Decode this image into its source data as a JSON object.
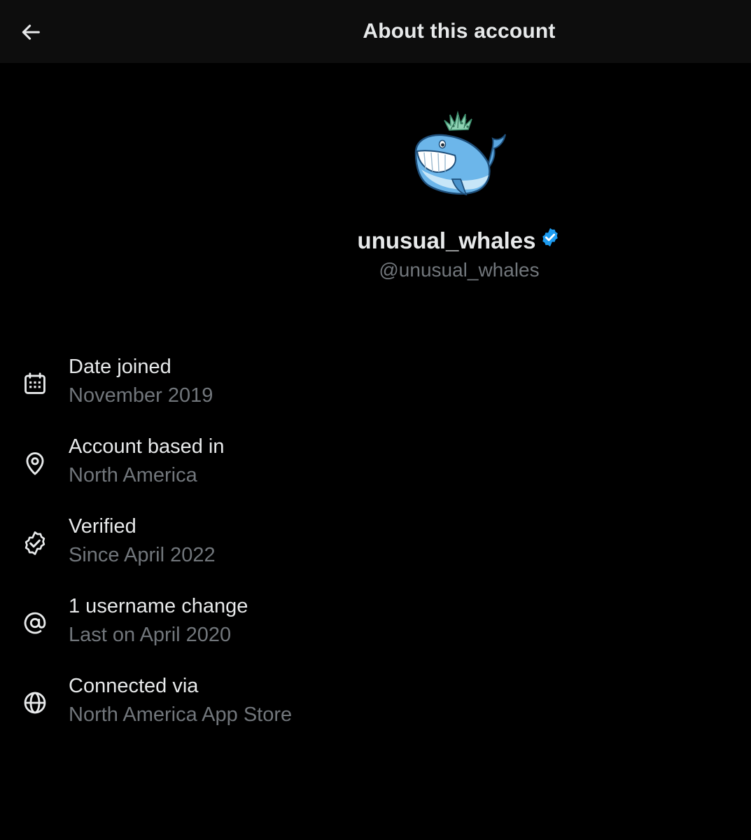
{
  "header": {
    "title": "About this account",
    "back_icon": "arrow-left-icon"
  },
  "profile": {
    "display_name": "unusual_whales",
    "handle": "@unusual_whales",
    "verified_badge_color": "#1d9bf0",
    "avatar": "whale-avatar"
  },
  "info": [
    {
      "icon": "calendar-icon",
      "label": "Date joined",
      "value": "November 2019"
    },
    {
      "icon": "location-pin-icon",
      "label": "Account based in",
      "value": "North America"
    },
    {
      "icon": "verified-badge-icon",
      "label": "Verified",
      "value": "Since April 2022"
    },
    {
      "icon": "at-sign-icon",
      "label": "1 username change",
      "value": "Last on April 2020"
    },
    {
      "icon": "globe-icon",
      "label": "Connected via",
      "value": "North America App Store"
    }
  ],
  "colors": {
    "background": "#000000",
    "header_background": "#0d0d0d",
    "primary_text": "#e7e9ea",
    "secondary_text": "#71767b",
    "accent": "#1d9bf0"
  }
}
